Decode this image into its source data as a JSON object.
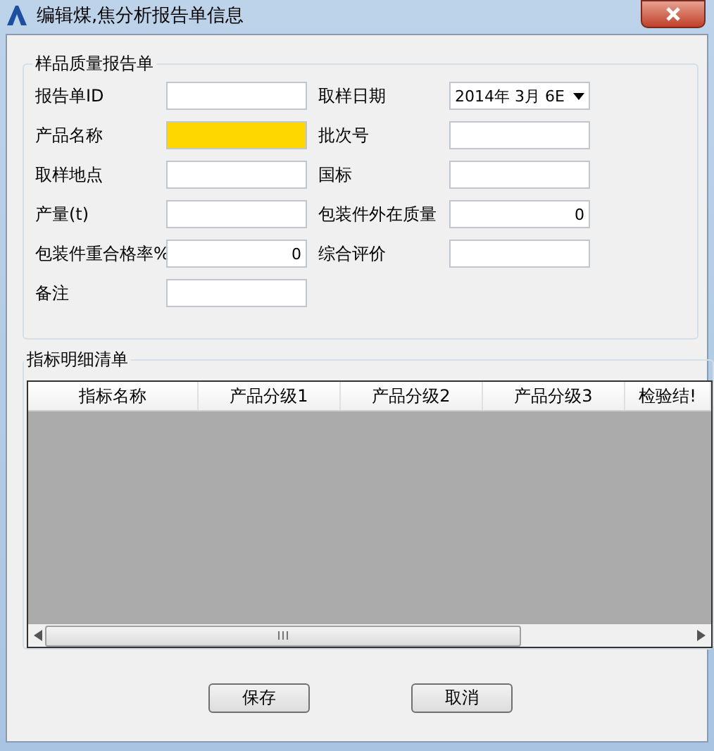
{
  "window": {
    "title": "编辑煤,焦分析报告单信息"
  },
  "report_group": {
    "title": "样品质量报告单",
    "rows": [
      [
        {
          "label": "报告单ID",
          "kind": "text",
          "highlighted": false
        },
        {
          "label": "取样日期",
          "kind": "date",
          "value": "2014年 3月 6E",
          "highlighted": false
        }
      ],
      [
        {
          "label": "产品名称",
          "kind": "text",
          "highlighted": true
        },
        {
          "label": "批次号",
          "kind": "text",
          "highlighted": false
        }
      ],
      [
        {
          "label": "取样地点",
          "kind": "text",
          "highlighted": false
        },
        {
          "label": "国标",
          "kind": "text",
          "highlighted": false
        }
      ],
      [
        {
          "label": "产量(t)",
          "kind": "text",
          "highlighted": false
        },
        {
          "label": "包装件外在质量",
          "kind": "number",
          "value": "0",
          "highlighted": false
        }
      ],
      [
        {
          "label": "包装件重合格率%",
          "kind": "number",
          "value": "0",
          "highlighted": false
        },
        {
          "label": "综合评价",
          "kind": "text",
          "highlighted": false
        }
      ],
      [
        {
          "label": "备注",
          "kind": "text",
          "highlighted": false
        }
      ]
    ]
  },
  "detail_group": {
    "title": "指标明细清单",
    "columns": [
      "指标名称",
      "产品分级1",
      "产品分级2",
      "产品分级3",
      "检验结!"
    ]
  },
  "buttons": [
    "保存",
    "取消"
  ]
}
